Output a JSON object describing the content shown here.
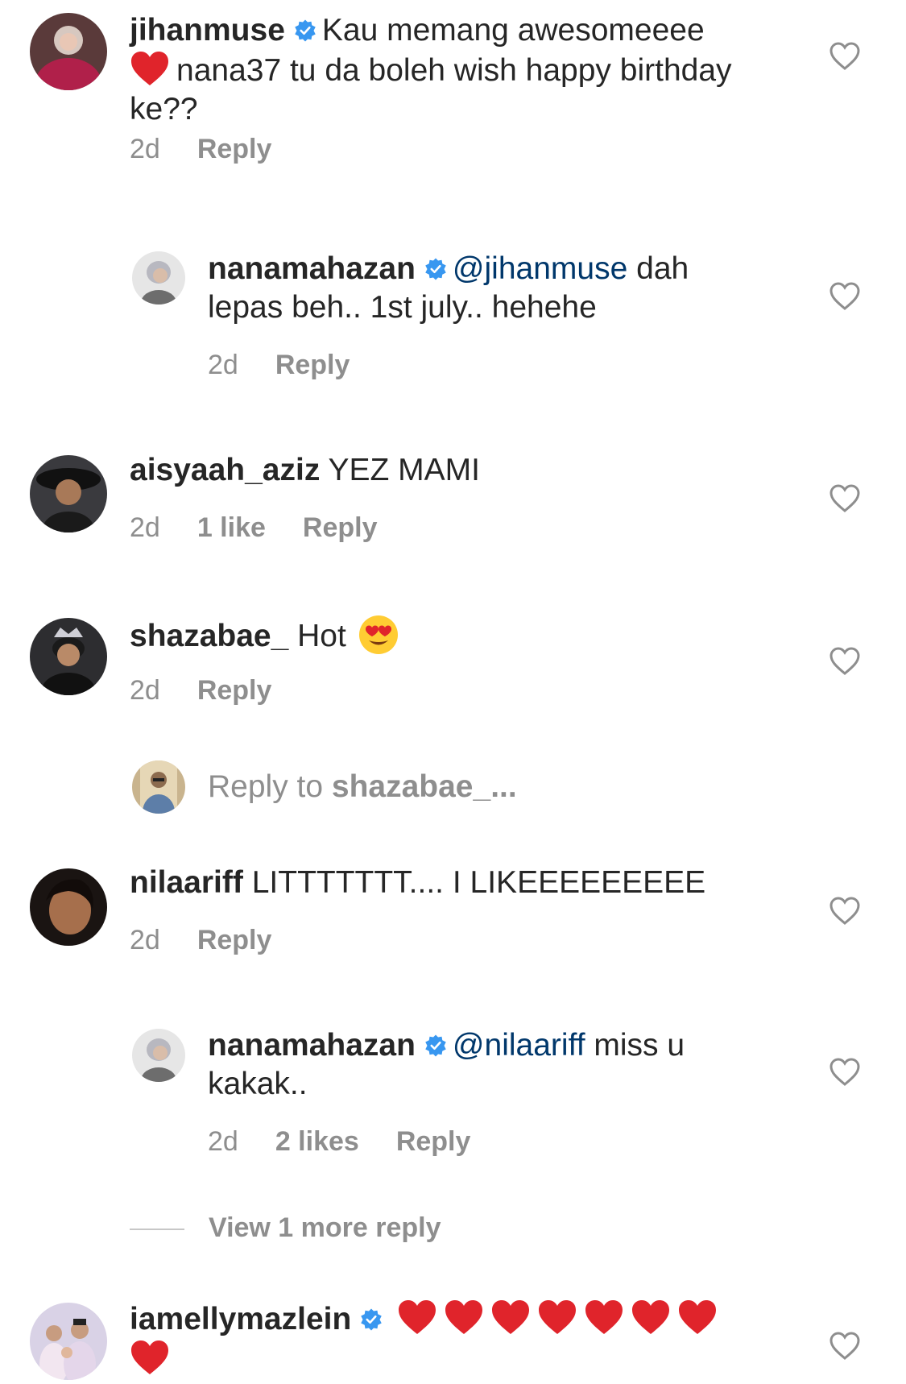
{
  "colors": {
    "text": "#262626",
    "muted": "#8e8e8e",
    "mention": "#00376b",
    "verified": "#3897f0",
    "heart_emoji": "#e0242b"
  },
  "comments": [
    {
      "username": "jihanmuse",
      "verified": true,
      "text_1": "Kau memang awesomeeee",
      "text_2": "nana37 tu da boleh wish happy birthday ke??",
      "time": "2d",
      "reply_label": "Reply"
    },
    {
      "username": "nanamahazan",
      "verified": true,
      "mention": "@jihanmuse",
      "text": "dah lepas beh.. 1st july.. hehehe",
      "time": "2d",
      "reply_label": "Reply"
    },
    {
      "username": "aisyaah_aziz",
      "text": "YEZ MAMI",
      "time": "2d",
      "likes": "1 like",
      "reply_label": "Reply"
    },
    {
      "username": "shazabae_",
      "text": "Hot",
      "time": "2d",
      "reply_label": "Reply"
    },
    {
      "username": "nilaariff",
      "text": "LITTTTTTT.... I LIKEEEEEEEEE",
      "time": "2d",
      "reply_label": "Reply"
    },
    {
      "username": "nanamahazan",
      "verified": true,
      "mention": "@nilaariff",
      "text": "miss u kakak..",
      "time": "2d",
      "likes": "2 likes",
      "reply_label": "Reply"
    },
    {
      "username": "iamellymazlein",
      "verified": true
    }
  ],
  "reply_input": {
    "prefix": "Reply to ",
    "target": "shazabae_..."
  },
  "view_more": "View 1 more reply"
}
